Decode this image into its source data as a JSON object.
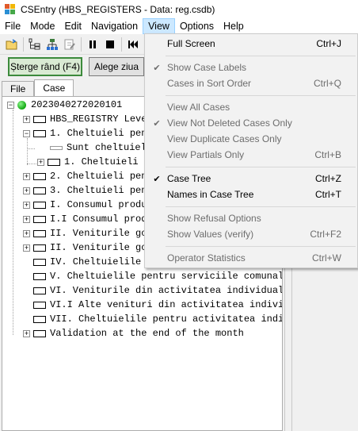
{
  "window": {
    "title": "CSEntry (HBS_REGISTERS - Data: reg.csdb)"
  },
  "menubar": [
    "File",
    "Mode",
    "Edit",
    "Navigation",
    "View",
    "Options",
    "Help"
  ],
  "toolbar": {
    "icons": [
      "open-folder-icon",
      "case-tree-icon",
      "network-icon",
      "edit-icon",
      "pause-icon",
      "stop-icon",
      "first-record-icon"
    ]
  },
  "actions": {
    "delete_row": "Șterge rând (F4)",
    "choose_day": "Alege ziua"
  },
  "tabs": [
    "File",
    "Case"
  ],
  "tree": [
    "2023040272020101",
    "HBS_REGISTRY Leve",
    "1. Cheltuieli pen",
    "Sunt cheltuiel",
    "1. Cheltuieli",
    "2. Cheltuieli pen",
    "3. Cheltuieli pen",
    "I. Consumul produ",
    "I.I Consumul prod",
    "II. Veniturile go",
    "II. Veniturile go",
    "IV. Cheltuielile",
    "V. Cheltuielile pentru serviciile comunale",
    "VI. Veniturile din activitatea individual",
    "VI.I Alte venituri din activitatea indivi",
    "VII. Cheltuielile pentru activitatea indiv",
    "Validation at the end of the month"
  ],
  "view_menu": {
    "items": [
      {
        "label": "Full Screen",
        "shortcut": "Ctrl+J",
        "enabled": true,
        "checked": false
      },
      {
        "label": "Show Case Labels",
        "shortcut": "",
        "enabled": false,
        "checked": true
      },
      {
        "label": "Cases in Sort Order",
        "shortcut": "Ctrl+Q",
        "enabled": false,
        "checked": false
      },
      {
        "label": "View All Cases",
        "shortcut": "",
        "enabled": false,
        "checked": false
      },
      {
        "label": "View Not Deleted Cases Only",
        "shortcut": "",
        "enabled": false,
        "checked": true
      },
      {
        "label": "View Duplicate Cases Only",
        "shortcut": "",
        "enabled": false,
        "checked": false
      },
      {
        "label": "View Partials Only",
        "shortcut": "Ctrl+B",
        "enabled": false,
        "checked": false
      },
      {
        "label": "Case Tree",
        "shortcut": "Ctrl+Z",
        "enabled": true,
        "checked": true
      },
      {
        "label": "Names in Case Tree",
        "shortcut": "Ctrl+T",
        "enabled": true,
        "checked": false
      },
      {
        "label": "Show Refusal Options",
        "shortcut": "",
        "enabled": false,
        "checked": false
      },
      {
        "label": "Show Values (verify)",
        "shortcut": "Ctrl+F2",
        "enabled": false,
        "checked": false
      },
      {
        "label": "Operator Statistics",
        "shortcut": "Ctrl+W",
        "enabled": false,
        "checked": false
      }
    ]
  },
  "colors": {
    "menu_highlight": "#cce8ff",
    "root_status": "#11a811"
  }
}
